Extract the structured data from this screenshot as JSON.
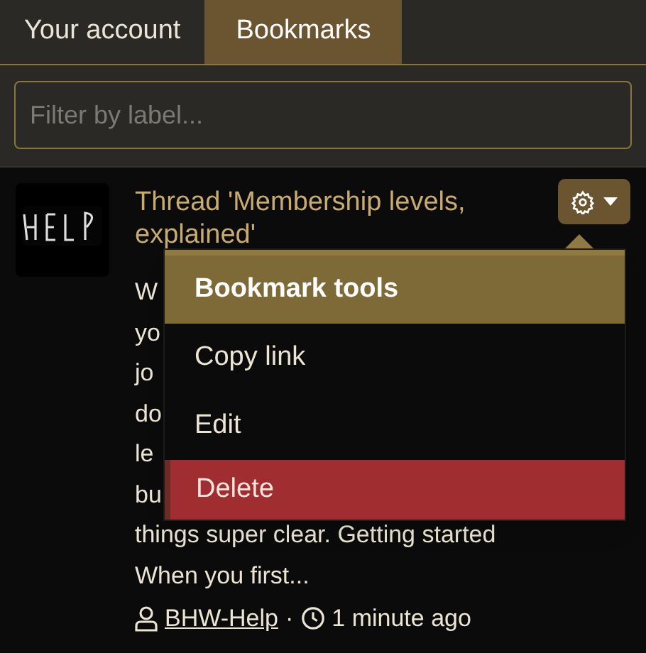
{
  "tabs": [
    {
      "label": "Your account",
      "selected": false
    },
    {
      "label": "Bookmarks",
      "selected": true
    }
  ],
  "filter": {
    "placeholder": "Filter by label..."
  },
  "bookmark": {
    "title": "Thread 'Membership levels, explained'",
    "snippet_lines": [
      "W",
      "yo",
      "jo",
      "do",
      "le",
      "bu",
      "things super clear. Getting started",
      "When you first..."
    ],
    "author": "BHW-Help",
    "separator": "·",
    "time": "1 minute ago"
  },
  "menu": {
    "items": [
      {
        "kind": "header",
        "label": "Bookmark tools"
      },
      {
        "kind": "link",
        "label": "Copy link"
      },
      {
        "kind": "link",
        "label": "Edit"
      },
      {
        "kind": "danger",
        "label": "Delete"
      }
    ]
  }
}
